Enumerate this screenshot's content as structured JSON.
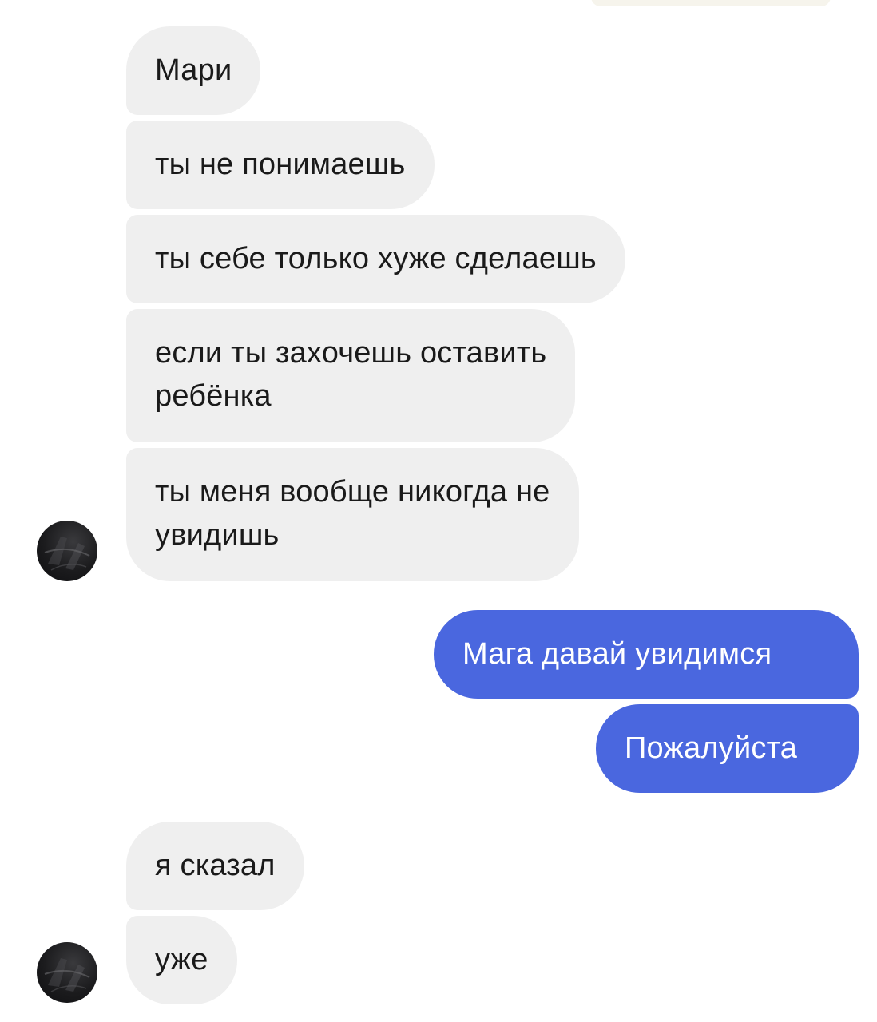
{
  "incoming_group_1": [
    "Мари",
    "ты не понимаешь",
    "ты себе только хуже сделаешь",
    "если ты захочешь оставить\nребёнка",
    "ты меня вообще никогда не\nувидишь"
  ],
  "outgoing_group": [
    "Мага давай увидимся",
    "Пожалуйста"
  ],
  "incoming_group_2": [
    "я сказал",
    "уже"
  ],
  "colors": {
    "incoming_bubble": "#efefef",
    "outgoing_bubble": "#4a67df",
    "incoming_text": "#1a1a1a",
    "outgoing_text": "#ffffff"
  },
  "icons": {
    "contact_avatar": "avatar-photo-icon"
  }
}
